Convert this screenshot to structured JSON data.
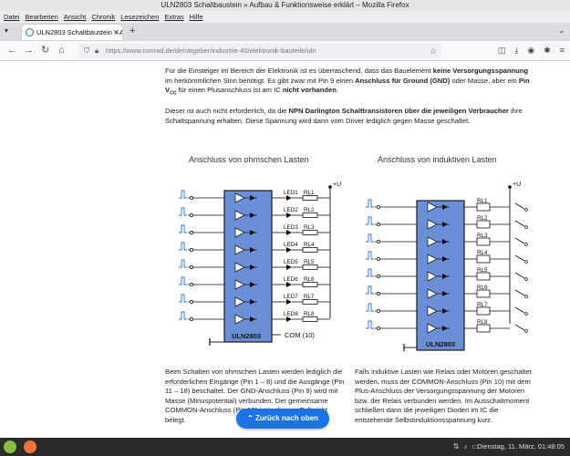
{
  "window": {
    "title": "ULN2803 Schaltbaustein » Aufbau & Funktionsweise erklärt – Mozilla Firefox"
  },
  "menu": [
    "Datei",
    "Bearbeiten",
    "Ansicht",
    "Chronik",
    "Lesezeichen",
    "Extras",
    "Hilfe"
  ],
  "tab": {
    "title": "ULN2803 Schaltbaustein » A"
  },
  "url": "https://www.conrad.de/de/ratgeber/industrie-40/elektronik-bauteile/uln",
  "content": {
    "p1_a": "Für die Einsteiger im Bereich der Elektronik ist es überraschend, dass das Bauelement ",
    "p1_b": "keine Versorgungsspannung",
    "p1_c": " im herkömmlichen Sinn benötigt. Es gibt zwar mit Pin 9 einen ",
    "p1_d": "Anschluss für Ground (GND)",
    "p1_e": " oder Masse, aber ein ",
    "p1_f": "Pin V",
    "p1_sub": "CC",
    "p1_g": " für einen Plusanschluss ist am IC ",
    "p1_h": "nicht vorhanden",
    "p1_i": ".",
    "p2_a": "Dieser ist auch nicht erforderlich, da die ",
    "p2_b": "NPN Darlington Schalttransistoren über die jeweiligen Verbraucher",
    "p2_c": " ihre Schaltspannung erhalten. Diese Spannung wird dann vom Driver lediglich gegen Masse geschaltet.",
    "heading_left": "Anschluss von ohmschen Lasten",
    "heading_right": "Anschluss von induktiven Lasten",
    "caption_left": "Beim Schalten von ohmschen Lasten werden lediglich die erforderlichen Eingänge (Pin 1 – 8) und die Ausgänge (Pin 11 – 18) beschaltet. Der GND-Anschluss (Pin 9) wird mit Masse (Minuspotential) verbunden. Der gemeinsame COMMON-Anschluss (Pin 10) ist in diesem Fall nicht belegt.",
    "caption_right": "Falls induktive Lasten wie Relais oder Motoren geschaltet werden, muss der COMMON-Anschluss (Pin 10) mit dem Plus-Anschluss der Versorgungsspannung der Motoren bzw. der Relais verbunden werden. Im Ausschaltmoment schließen dann die jeweiligen Dioden im IC die entstehende Selbstinduktionsspannung kurz."
  },
  "diagram_left": {
    "chip_label": "ULN2803",
    "supply_label": "+U",
    "com_label": "COM (10)",
    "leds": [
      "LED1",
      "LED2",
      "LED3",
      "LED4",
      "LED5",
      "LED6",
      "LED7",
      "LED8"
    ],
    "resistors": [
      "RL1",
      "RL2",
      "RL3",
      "RL4",
      "RL5",
      "RL6",
      "RL7",
      "RL8"
    ]
  },
  "diagram_right": {
    "chip_label": "ULN2803",
    "supply_label": "+U",
    "relays": [
      "RL1",
      "RL2",
      "RL3",
      "RL4",
      "RL5",
      "RL6",
      "RL7",
      "RL8"
    ]
  },
  "back_button": "Zurück nach oben",
  "taskbar": {
    "clock": "Dienstag, 11. März, 01:48:05"
  },
  "colors": {
    "chip_fill": "#6b8fd6",
    "chip_stroke": "#1a1a1a",
    "accent": "#1a73e8",
    "taskbar": "#2b2b2b"
  }
}
